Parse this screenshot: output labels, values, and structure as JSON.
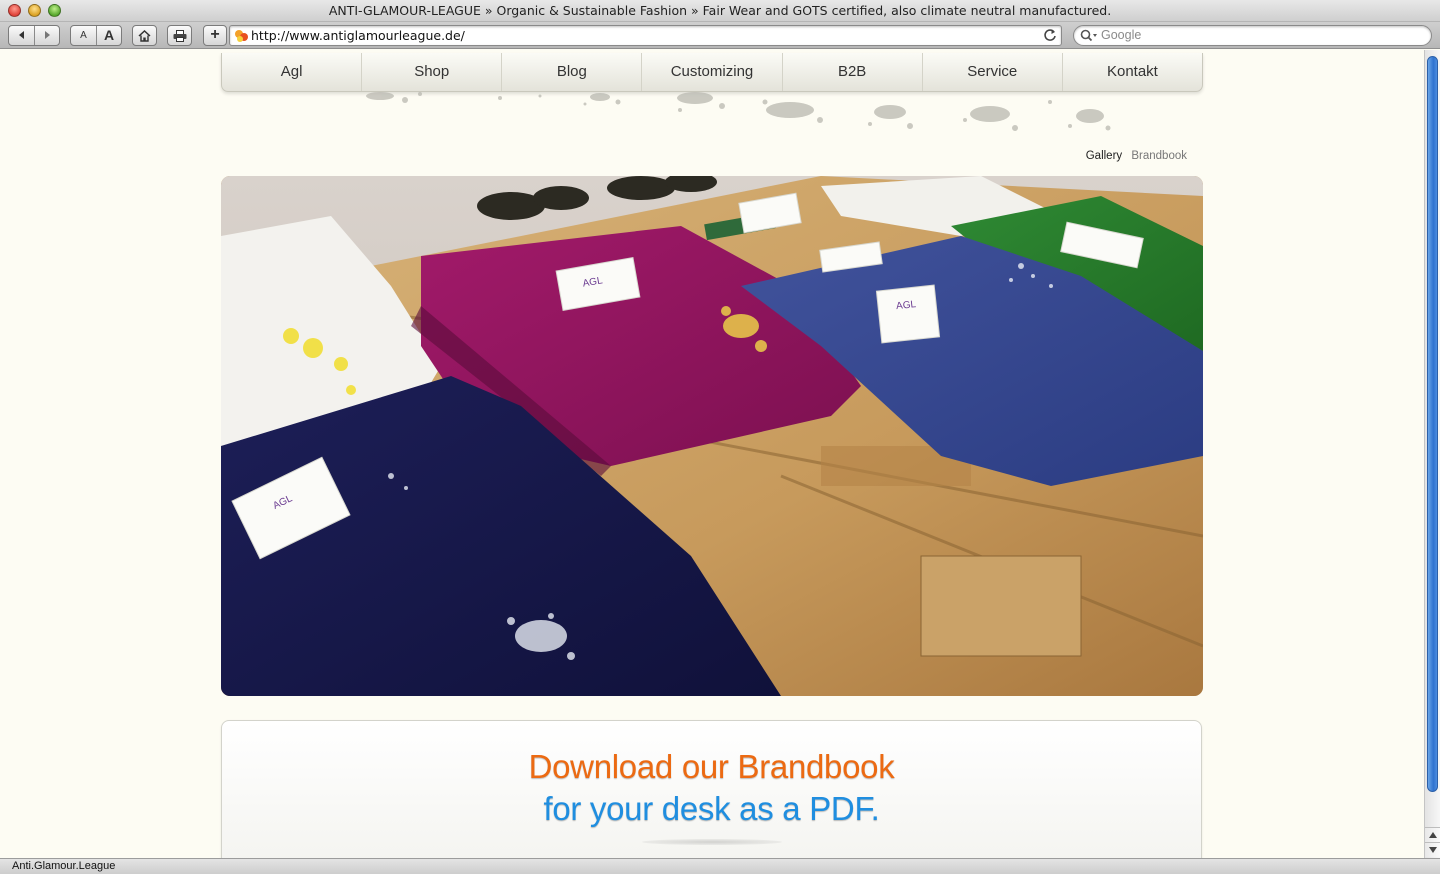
{
  "window": {
    "title": "ANTI-GLAMOUR-LEAGUE » Organic & Sustainable Fashion » Fair Wear and GOTS certified, also climate neutral manufactured."
  },
  "toolbar": {
    "back_icon": "back-arrow-icon",
    "forward_icon": "forward-arrow-icon",
    "text_smaller_label": "A",
    "text_larger_label": "A",
    "home_icon": "home-icon",
    "print_icon": "print-icon",
    "add_bookmark_label": "+",
    "url": "http://www.antiglamourleague.de/",
    "search_placeholder": "Google"
  },
  "nav": {
    "items": [
      {
        "label": "Agl"
      },
      {
        "label": "Shop"
      },
      {
        "label": "Blog"
      },
      {
        "label": "Customizing"
      },
      {
        "label": "B2B"
      },
      {
        "label": "Service"
      },
      {
        "label": "Kontakt"
      }
    ]
  },
  "subnav": {
    "gallery": "Gallery",
    "brandbook": "Brandbook"
  },
  "brandbook": {
    "line1": "Download our Brandbook",
    "line2": "for your desk as a PDF."
  },
  "statusbar": {
    "text": "Anti.Glamour.League"
  },
  "colors": {
    "page_background": "#fdfcf3",
    "accent_orange": "#ec6a12",
    "accent_blue": "#1f8ee0",
    "scroll_thumb": "#2f72cf"
  }
}
